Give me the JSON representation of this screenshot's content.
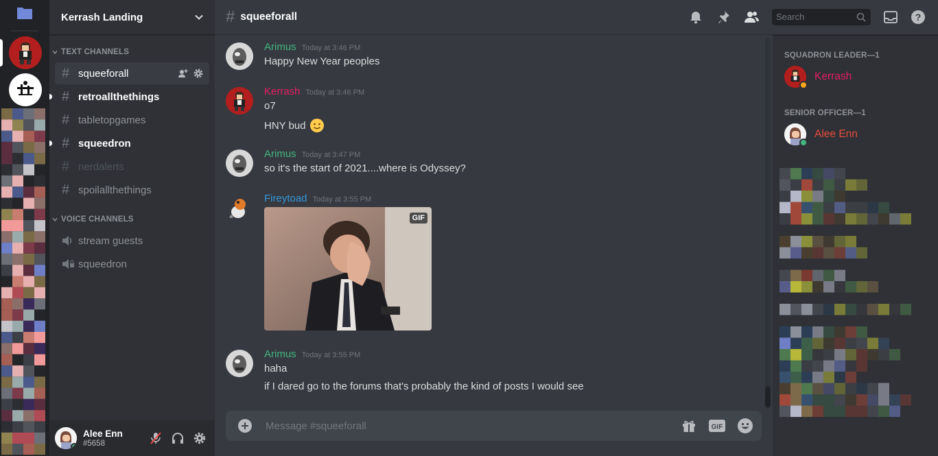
{
  "server": {
    "name": "Kerrash Landing"
  },
  "categories": {
    "text": "TEXT CHANNELS",
    "voice": "VOICE CHANNELS"
  },
  "text_channels": [
    {
      "name": "squeeforall",
      "state": "active"
    },
    {
      "name": "retroallthethings",
      "state": "unread"
    },
    {
      "name": "tabletopgames",
      "state": "normal"
    },
    {
      "name": "squeedron",
      "state": "unread"
    },
    {
      "name": "nerdalerts",
      "state": "muted"
    },
    {
      "name": "spoilallthethings",
      "state": "normal"
    }
  ],
  "voice_channels": [
    {
      "name": "stream guests"
    },
    {
      "name": "squeedron"
    }
  ],
  "user": {
    "name": "Alee Enn",
    "tag": "#5658"
  },
  "header": {
    "channel": "squeeforall",
    "search_placeholder": "Search"
  },
  "messages": [
    {
      "author": "Arimus",
      "color": "#43b581",
      "time": "Today at 3:46 PM",
      "lines": [
        "Happy New Year peoples"
      ]
    },
    {
      "author": "Kerrash",
      "color": "#e91e63",
      "time": "Today at 3:46 PM",
      "lines": [
        "o7",
        "HNY bud"
      ]
    },
    {
      "author": "Arimus",
      "color": "#43b581",
      "time": "Today at 3:47 PM",
      "lines": [
        "so it's the start of 2021....where is Odyssey?"
      ]
    },
    {
      "author": "Fireytoad",
      "color": "#3498db",
      "time": "Today at 3:55 PM",
      "lines": [],
      "attachment": "GIF"
    },
    {
      "author": "Arimus",
      "color": "#43b581",
      "time": "Today at 3:55 PM",
      "lines": [
        "haha",
        "if I dared go to the forums that's probably the kind of posts I would see"
      ]
    }
  ],
  "composer": {
    "placeholder": "Message #squeeforall"
  },
  "member_groups": [
    {
      "title": "SQUADRON LEADER—1",
      "members": [
        {
          "name": "Kerrash",
          "color": "#e91e63"
        }
      ]
    },
    {
      "title": "SENIOR OFFICER—1",
      "members": [
        {
          "name": "Alee Enn",
          "color": "#e74c3c"
        }
      ]
    }
  ],
  "colors": {
    "online": "#43b581",
    "idle": "#faa61a",
    "accent": "#7289da"
  }
}
